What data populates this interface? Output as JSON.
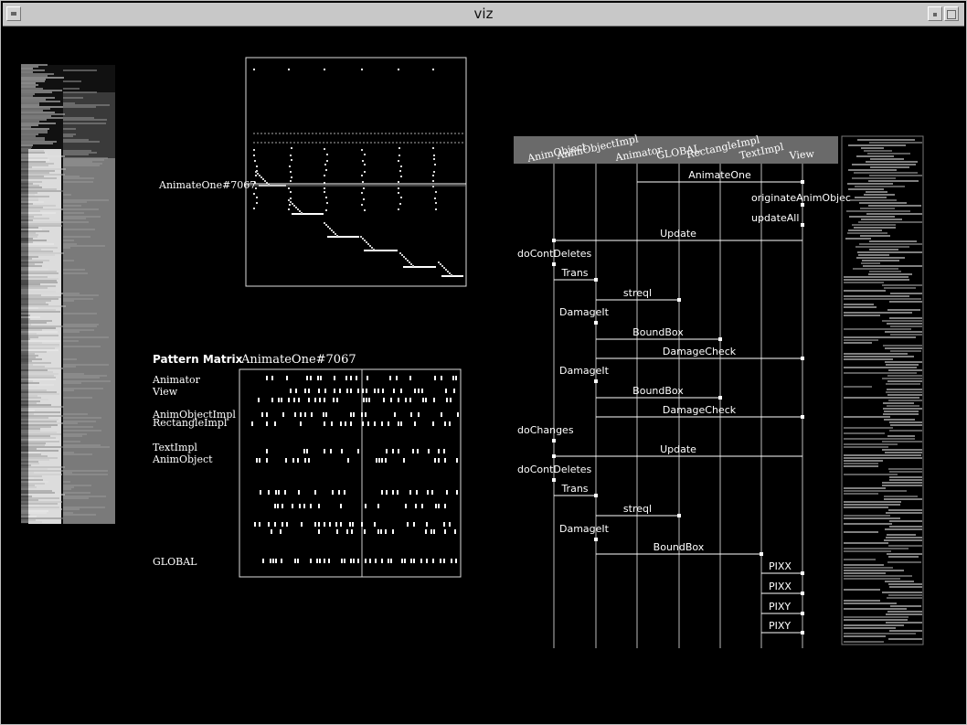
{
  "window": {
    "title": "viz",
    "menu_icon": "window-menu-icon",
    "minimize_icon": "minimize-icon",
    "maximize_icon": "maximize-icon"
  },
  "colors": {
    "background": "#000000",
    "foreground": "#ffffff",
    "titlebar": "#c8c8c8",
    "header_strip": "#6a6a6a"
  },
  "timeline": {
    "label": "AnimateOne#7067"
  },
  "pattern_matrix": {
    "title": "Pattern Matrix",
    "instance": "AnimateOne#7067",
    "rows": [
      "Animator",
      "View",
      "AnimObjectImpl",
      "RectangleImpl",
      "TextImpl",
      "AnimObject",
      "GLOBAL"
    ]
  },
  "sequence": {
    "objects": [
      "AnimObject",
      "AnimObjectImpl",
      "Animator",
      "GLOBAL",
      "RectangleImpl",
      "TextImpl",
      "View"
    ],
    "messages": [
      "AnimateOne",
      "originateAnimObjec",
      "updateAll",
      "Update",
      "doContDeletes",
      "Trans",
      "streql",
      "DamageIt",
      "BoundBox",
      "DamageCheck",
      "DamageIt",
      "BoundBox",
      "DamageCheck",
      "doChanges",
      "Update",
      "doContDeletes",
      "Trans",
      "streql",
      "DamageIt",
      "BoundBox",
      "PIXX",
      "PIXX",
      "PIXY",
      "PIXY"
    ]
  }
}
